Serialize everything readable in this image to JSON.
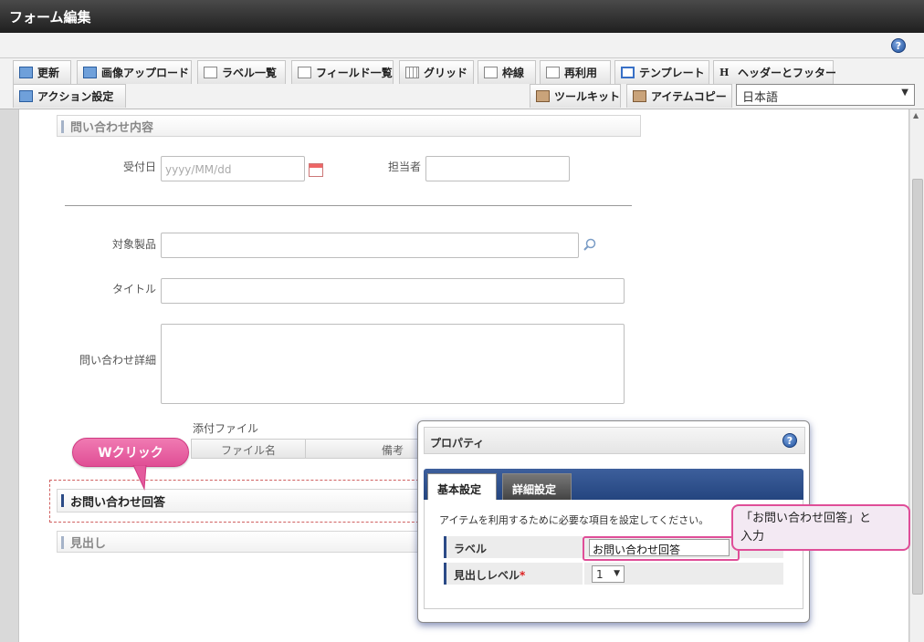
{
  "window": {
    "title": "フォーム編集"
  },
  "toolbar": {
    "row1": [
      {
        "label": "更新",
        "icon": "refresh-icon"
      },
      {
        "label": "画像アップロード",
        "icon": "image-upload-icon"
      },
      {
        "label": "ラベル一覧",
        "icon": "label-list-icon"
      },
      {
        "label": "フィールド一覧",
        "icon": "field-list-icon"
      },
      {
        "label": "グリッド",
        "icon": "grid-icon"
      },
      {
        "label": "枠線",
        "icon": "border-icon"
      },
      {
        "label": "再利用",
        "icon": "reuse-icon"
      },
      {
        "label": "テンプレート",
        "icon": "template-icon"
      },
      {
        "label": "ヘッダーとフッター",
        "icon": "header-footer-icon"
      }
    ],
    "action_label": "アクション設定",
    "toolkit_label": "ツールキット",
    "item_copy_label": "アイテムコピー",
    "language": "日本語",
    "help": "?"
  },
  "form": {
    "section_title": "問い合わせ内容",
    "reception_date_label": "受付日",
    "reception_date_placeholder": "yyyy/MM/dd",
    "assignee_label": "担当者",
    "product_label": "対象製品",
    "title_label": "タイトル",
    "detail_label": "問い合わせ詳細",
    "attachment_label": "添付ファイル",
    "attachment_columns": [
      "ファイル名",
      "備考"
    ],
    "answer_heading": "お問い合わせ回答",
    "generic_heading": "見出し"
  },
  "callout": {
    "double_click": "Wクリック"
  },
  "dialog": {
    "title": "プロパティ",
    "help": "?",
    "tabs": [
      "基本設定",
      "詳細設定"
    ],
    "description": "アイテムを利用するために必要な項目を設定してください。",
    "label_field_label": "ラベル",
    "label_field_value": "お問い合わせ回答",
    "heading_level_label": "見出しレベル",
    "required_mark": "*",
    "heading_level_value": "1"
  },
  "note": {
    "line1": "「お問い合わせ回答」と",
    "line2": "入力"
  },
  "colors": {
    "accent_pink": "#e04e95",
    "navy": "#2b4a86"
  }
}
